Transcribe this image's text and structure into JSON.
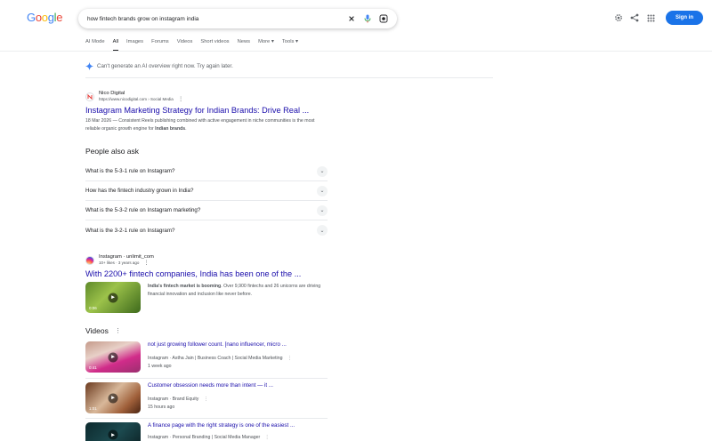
{
  "logo": {
    "letters": [
      "G",
      "o",
      "o",
      "g",
      "l",
      "e"
    ]
  },
  "search": {
    "query": "how fintech brands grow on instagram india"
  },
  "header": {
    "signin_label": "Sign in"
  },
  "tabs": [
    "AI Mode",
    "All",
    "Images",
    "Forums",
    "Videos",
    "Short videos",
    "News",
    "More",
    "Tools"
  ],
  "active_tab": "All",
  "ai_overview": {
    "message": "Can't generate an AI overview right now. Try again later."
  },
  "result1": {
    "site_name": "Nico Digital",
    "url": "https://www.nicodigital.com › Social Media",
    "title": "Instagram Marketing Strategy for Indian Brands: Drive Real ...",
    "desc_pre": "18 Mar 2026 — Consistent Reels publishing combined with active engagement in niche communities is the most reliable organic growth engine for ",
    "desc_bold": "Indian brands",
    "desc_post": "."
  },
  "people_also_ask": {
    "title": "People also ask",
    "questions": [
      "What is the 5-3-1 rule on Instagram?",
      "How has the fintech industry grown in India?",
      "What is the 5-3-2 rule on Instagram marketing?",
      "What is the 3-2-1 rule on Instagram?"
    ]
  },
  "result2": {
    "site_name": "Instagram · unlimit_com",
    "meta": "10+ likes · 3 years ago",
    "title": "With 2200+ fintech companies, India has been one of the ...",
    "duration": "0:06",
    "desc_bold": "India's fintech market is booming",
    "desc_post": ". Over 9,900 fintechs and 26 unicorns are driving financial innovation and inclusion like never before."
  },
  "videos": {
    "title": "Videos",
    "items": [
      {
        "title": "not just growing follower count. [nano influencer, micro ...",
        "source": "Instagram · Astha Jain | Business Coach | Social Media Marketing",
        "age": "1 week ago",
        "duration": "0:41"
      },
      {
        "title": "Customer obsession needs more than intent — it ...",
        "source": "Instagram · Brand Equity",
        "age": "15 hours ago",
        "duration": "1:01"
      },
      {
        "title": "A finance page with the right strategy is one of the easiest ...",
        "source": "Instagram · Personal Branding | Social Media Manager",
        "age": "",
        "duration": ""
      }
    ]
  },
  "colors": {
    "link": "#1a0dab",
    "signin": "#1a73e8",
    "text": "#202124",
    "muted": "#4d5156"
  }
}
